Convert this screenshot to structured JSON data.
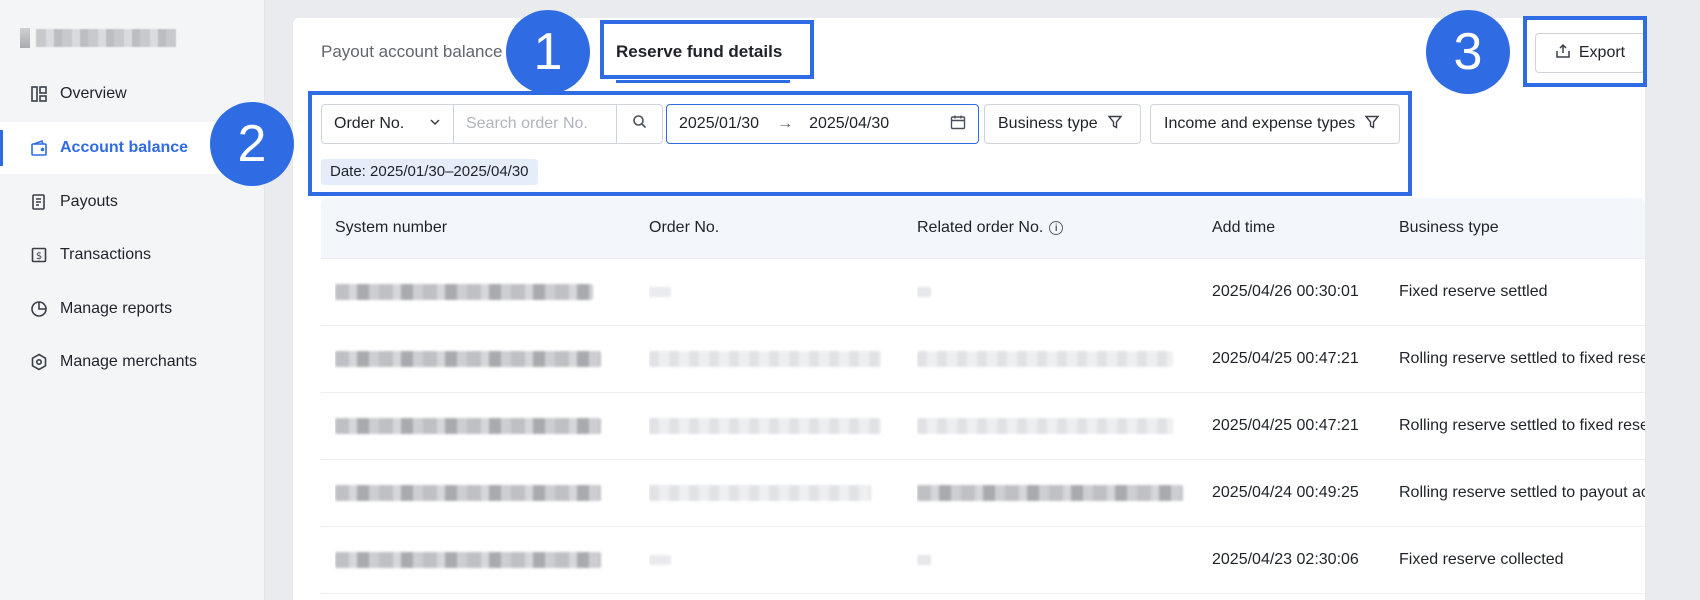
{
  "sidebar": {
    "items": [
      {
        "label": "Overview",
        "icon": "overview-icon"
      },
      {
        "label": "Account balance",
        "icon": "wallet-icon",
        "active": true
      },
      {
        "label": "Payouts",
        "icon": "payout-icon"
      },
      {
        "label": "Transactions",
        "icon": "transaction-icon"
      },
      {
        "label": "Manage reports",
        "icon": "pie-chart-icon"
      },
      {
        "label": "Manage merchants",
        "icon": "hexagon-icon"
      }
    ]
  },
  "tabs": {
    "payout_label": "Payout account balance",
    "reserve_label": "Reserve fund details"
  },
  "export_label": "Export",
  "filters": {
    "order_select": "Order No.",
    "search_placeholder": "Search order No.",
    "date_start": "2025/01/30",
    "date_end": "2025/04/30",
    "business_type": "Business type",
    "income_expense": "Income and expense types",
    "date_tag": "Date: 2025/01/30–2025/04/30"
  },
  "table": {
    "headers": [
      "System number",
      "Order No.",
      "Related order No.",
      "Add time",
      "Business type"
    ],
    "rows": [
      {
        "add_time": "2025/04/26 00:30:01",
        "business_type": "Fixed reserve settled"
      },
      {
        "add_time": "2025/04/25 00:47:21",
        "business_type": "Rolling reserve settled to fixed rese"
      },
      {
        "add_time": "2025/04/25 00:47:21",
        "business_type": "Rolling reserve settled to fixed rese"
      },
      {
        "add_time": "2025/04/24 00:49:25",
        "business_type": "Rolling reserve settled to payout ac"
      },
      {
        "add_time": "2025/04/23 02:30:06",
        "business_type": "Fixed reserve collected"
      }
    ]
  },
  "annotations": [
    "1",
    "2",
    "3"
  ],
  "colors": {
    "accent": "#2f6be3",
    "annotation": "#2f6be3"
  }
}
